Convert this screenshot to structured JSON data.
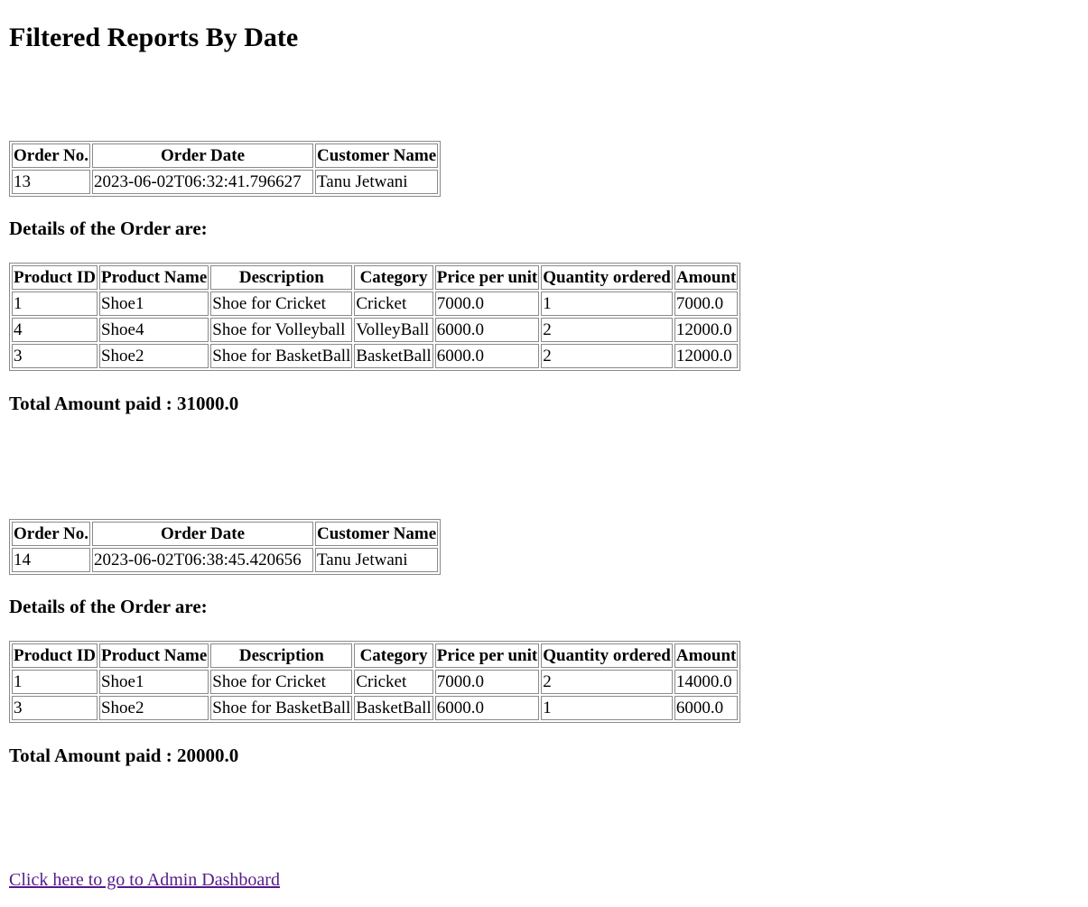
{
  "page_title": "Filtered Reports By Date",
  "summary_headers": [
    "Order No.",
    "Order Date",
    "Customer Name"
  ],
  "details_heading": "Details of the Order are:",
  "details_headers": [
    "Product ID",
    "Product Name",
    "Description",
    "Category",
    "Price per unit",
    "Quantity ordered",
    "Amount"
  ],
  "orders": [
    {
      "order_no": "13",
      "order_date": "2023-06-02T06:32:41.796627",
      "customer_name": "Tanu Jetwani",
      "items": [
        [
          "1",
          "Shoe1",
          "Shoe for Cricket",
          "Cricket",
          "7000.0",
          "1",
          "7000.0"
        ],
        [
          "4",
          "Shoe4",
          "Shoe for Volleyball",
          "VolleyBall",
          "6000.0",
          "2",
          "12000.0"
        ],
        [
          "3",
          "Shoe2",
          "Shoe for BasketBall",
          "BasketBall",
          "6000.0",
          "2",
          "12000.0"
        ]
      ],
      "total_label": "Total Amount paid : 31000.0"
    },
    {
      "order_no": "14",
      "order_date": "2023-06-02T06:38:45.420656",
      "customer_name": "Tanu Jetwani",
      "items": [
        [
          "1",
          "Shoe1",
          "Shoe for Cricket",
          "Cricket",
          "7000.0",
          "2",
          "14000.0"
        ],
        [
          "3",
          "Shoe2",
          "Shoe for BasketBall",
          "BasketBall",
          "6000.0",
          "1",
          "6000.0"
        ]
      ],
      "total_label": "Total Amount paid : 20000.0"
    }
  ],
  "dashboard_link_text": "Click here to go to Admin Dashboard"
}
